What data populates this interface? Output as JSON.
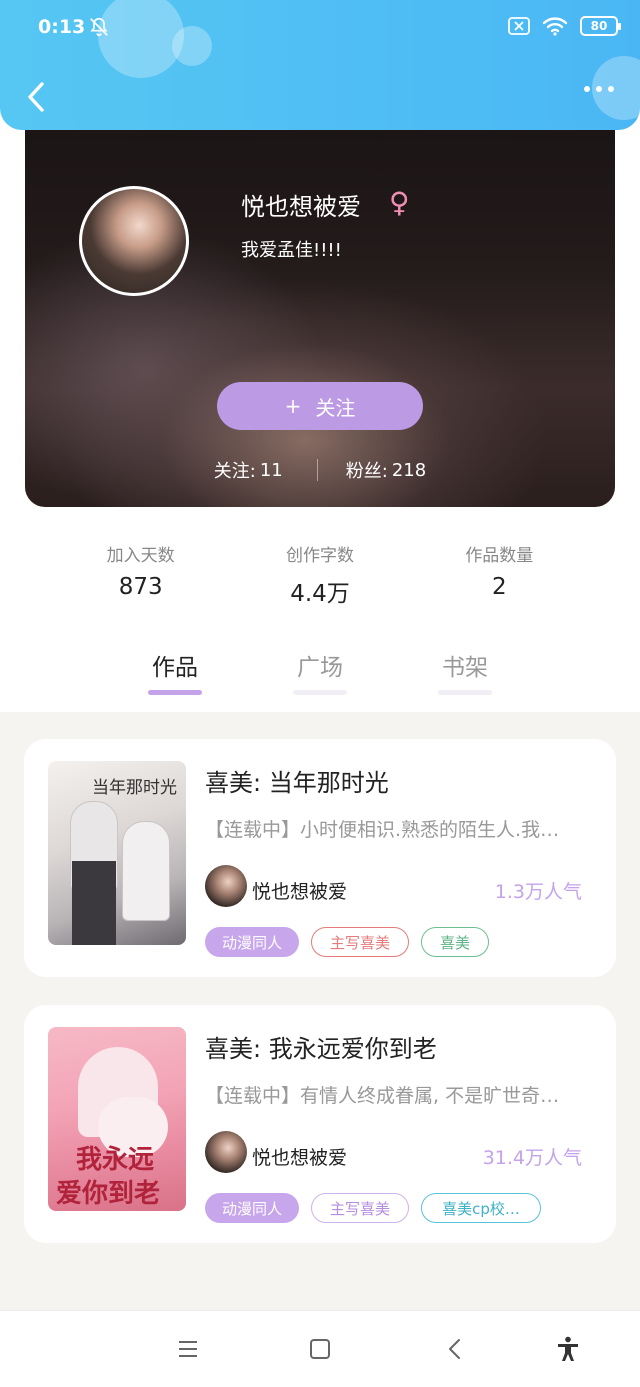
{
  "status_bar": {
    "time": "0:13",
    "battery": "80"
  },
  "profile": {
    "nickname": "悦也想被爱",
    "gender_symbol": "♀",
    "bio": "我爱孟佳!!!!",
    "follow_label": "关注",
    "follow_plus": "+",
    "following_label": "关注:",
    "following_count": "11",
    "fans_label": "粉丝:",
    "fans_count": "218"
  },
  "stats": [
    {
      "label": "加入天数",
      "value": "873"
    },
    {
      "label": "创作字数",
      "value": "4.4万"
    },
    {
      "label": "作品数量",
      "value": "2"
    }
  ],
  "tabs": [
    {
      "label": "作品",
      "active": true
    },
    {
      "label": "广场",
      "active": false
    },
    {
      "label": "书架",
      "active": false
    }
  ],
  "books": [
    {
      "title": "喜美: 当年那时光",
      "description": "【连载中】小时便相识.熟悉的陌生人.我…",
      "author": "悦也想被爱",
      "popularity": "1.3万人气",
      "tags": [
        "动漫同人",
        "主写喜美",
        "喜美"
      ],
      "cover_text": "当年那时光"
    },
    {
      "title": "喜美: 我永远爱你到老",
      "description": "【连载中】有情人终成眷属, 不是旷世奇…",
      "author": "悦也想被爱",
      "popularity": "31.4万人气",
      "tags": [
        "动漫同人",
        "主写喜美",
        "喜美cp校…"
      ],
      "cover_text_line1": "我永远",
      "cover_text_line2": "爱你到老"
    }
  ],
  "colors": {
    "header_blue": "#4ab7f4",
    "accent_purple": "#c4a3ea",
    "follow_button": "#bd9ae4",
    "gender_pink": "#f08fb4"
  }
}
